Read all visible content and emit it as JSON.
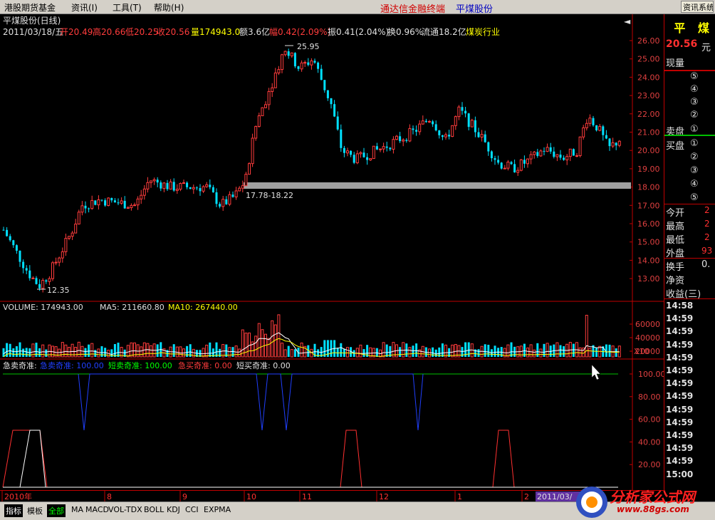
{
  "menubar": {
    "left_title": "港股期货基金",
    "menus": [
      "资讯(I)",
      "工具(T)",
      "帮助(H)"
    ],
    "app_title": "通达信金融终端",
    "stock_title": "平煤股份",
    "sys_button": "资讯系统"
  },
  "chart": {
    "header_name": "平煤股份(日线)",
    "info_date": "2011/03/18/五",
    "open_label": "开20.49",
    "high_label": "高20.66",
    "low_label": "低20.25",
    "close_label": "收20.56",
    "vol_label": "量174943.0",
    "amount_label": "额3.6亿",
    "change_label": "幅0.42(2.09%)",
    "amp_label": "振0.41(2.04%)",
    "turnover_label": "换0.96%",
    "float_label": "流通18.2亿",
    "industry_label": "煤炭行业",
    "high_mark": "25.95",
    "low_mark": "12.35",
    "band_label": "17.78-18.22",
    "price_axis": [
      "26.00",
      "25.00",
      "24.00",
      "23.00",
      "22.00",
      "21.00",
      "20.00",
      "19.00",
      "18.00",
      "17.00",
      "16.00",
      "15.00",
      "14.00",
      "13.00"
    ]
  },
  "volume": {
    "vol_label": "VOLUME: 174943.00",
    "ma5_label": "MA5: 211660.80",
    "ma10_label": "MA10: 267440.00",
    "axis": [
      "60000",
      "40000",
      "20000"
    ],
    "unit": "X10"
  },
  "indicator": {
    "title": "急卖奇准:",
    "s1": "急卖奇准: 100.00",
    "s2": "短卖奇准: 100.00",
    "s3": "急买奇准: 0.00",
    "s4": "短买奇准: 0.00",
    "axis": [
      "100.00",
      "80.00",
      "60.00",
      "40.00",
      "20.00"
    ]
  },
  "dates": {
    "labels": [
      "2010年",
      "8",
      "9",
      "10",
      "11",
      "12",
      "1",
      "2"
    ],
    "end_label": "2011/03/"
  },
  "rpanel": {
    "name": "平 煤",
    "price": "20.56",
    "price_unit": "元",
    "xianliang": "现量",
    "sell_label": "卖盘",
    "buy_label": "买盘",
    "levels_sell": [
      "⑤",
      "④",
      "③",
      "②",
      "①"
    ],
    "levels_buy": [
      "①",
      "②",
      "③",
      "④",
      "⑤"
    ],
    "jinkai": "今开",
    "zuigao": "最高",
    "zuidi": "最低",
    "waipan": "外盘",
    "huanshou": "换手",
    "jingzi": "净资",
    "shouyi": "收益(三)",
    "jinkai_v": "2",
    "zuigao_v": "2",
    "zuidi_v": "2",
    "waipan_v": "93",
    "huanshou_v": "0.",
    "times": [
      "14:58",
      "14:59",
      "14:59",
      "14:59",
      "14:59",
      "14:59",
      "14:59",
      "14:59",
      "14:59",
      "14:59",
      "14:59",
      "14:59",
      "14:59",
      "15:00"
    ]
  },
  "tabs": [
    "指标",
    "模板",
    "全部",
    "MA",
    "MACD",
    "VOL-TDX",
    "BOLL",
    "KDJ",
    "CCI",
    "EXPMA"
  ],
  "watermark": {
    "text": "分析家公式网",
    "url": "www.88gs.com"
  },
  "colors": {
    "up": "#ff3c3c",
    "down": "#00e0ff",
    "band": "#a0a0a0",
    "ma5": "#ffffff",
    "ma10": "#ffff00"
  }
}
